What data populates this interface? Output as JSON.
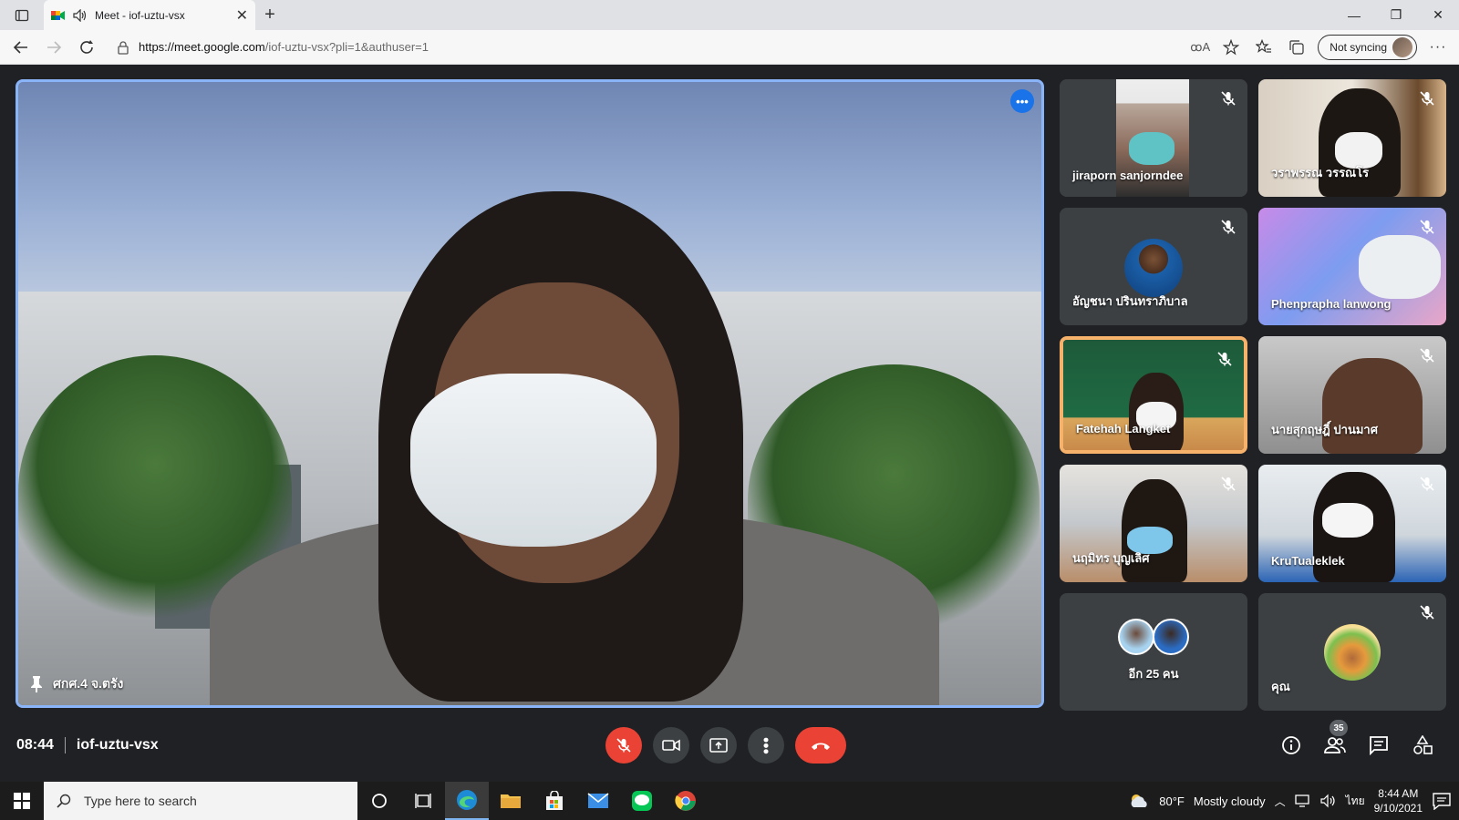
{
  "browser": {
    "tab_title": "Meet - iof-uztu-vsx",
    "url_host": "https://meet.google.com",
    "url_path": "/iof-uztu-vsx?pli=1&authuser=1",
    "sync_label": "Not syncing",
    "read_aloud_glyph": "ꚙA"
  },
  "main_tile": {
    "name": "ศกศ.4 จ.ตรัง"
  },
  "participants": [
    {
      "name": "jiraporn sanjorndee",
      "muted": true
    },
    {
      "name": "วราพรรณ วรรณโร",
      "muted": true
    },
    {
      "name": "อัญชนา ปรินทราภิบาล",
      "muted": true
    },
    {
      "name": "Phenprapha lanwong",
      "muted": true
    },
    {
      "name": "Fatehah Langket",
      "muted": true,
      "active_speaker": true
    },
    {
      "name": "นายสุกฤษฎิ์ ปานมาศ",
      "muted": true
    },
    {
      "name": "นฤมิทร บุญเลิศ",
      "muted": true
    },
    {
      "name": "KruTualeklek",
      "muted": true
    }
  ],
  "others_tile": {
    "label": "อีก 25 คน"
  },
  "self_tile": {
    "label": "คุณ",
    "muted": true
  },
  "meeting": {
    "time": "08:44",
    "code": "iof-uztu-vsx",
    "participant_count": "35"
  },
  "taskbar": {
    "search_placeholder": "Type here to search",
    "weather_temp": "80°F",
    "weather_text": "Mostly cloudy",
    "lang": "ไทย",
    "time": "8:44 AM",
    "date": "9/10/2021"
  },
  "colors": {
    "meet_bg": "#202124",
    "tile_bg": "#3c4043",
    "end_call": "#ea4335",
    "active_border": "#8ab4f8",
    "speaker_border": "#f6b26b"
  }
}
